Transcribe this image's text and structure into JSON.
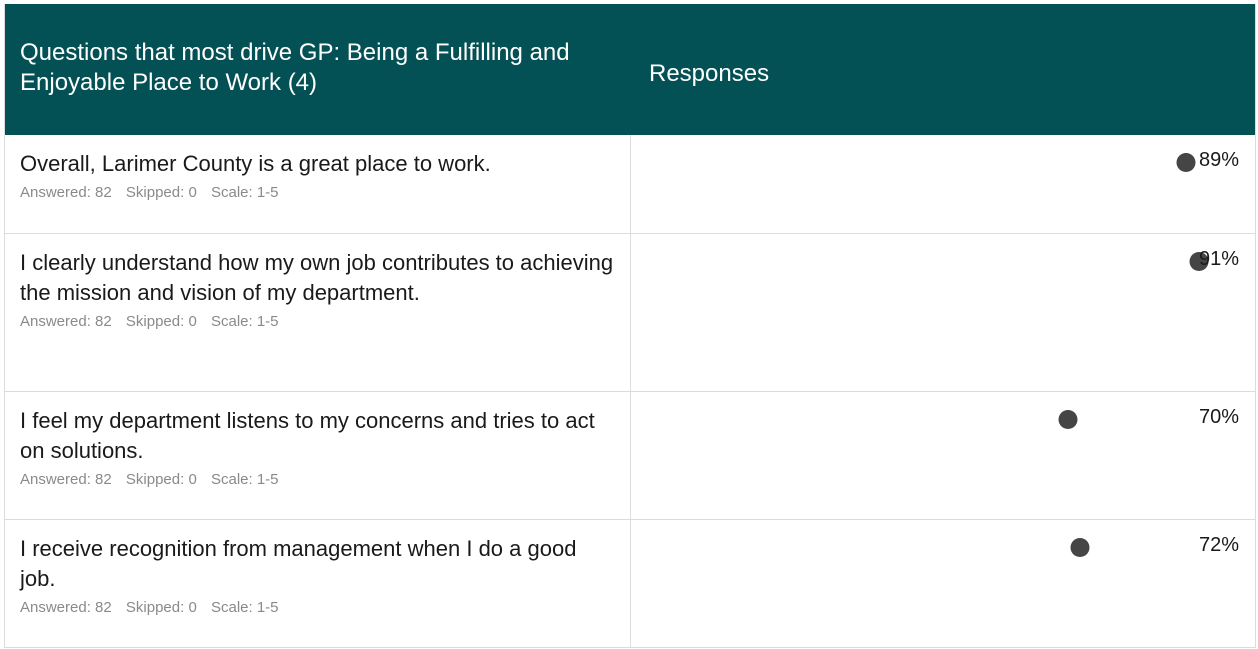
{
  "header": {
    "questions_label": "Questions that most drive GP: Being a Fulfilling and Enjoyable Place to Work (4)",
    "responses_label": "Responses"
  },
  "rows": [
    {
      "question": "Overall, Larimer County is a great place to work.",
      "answered": "Answered: 82",
      "skipped": "Skipped: 0",
      "scale": "Scale: 1-5",
      "percent_label": "89%",
      "percent": 89
    },
    {
      "question": "I clearly understand how my own job contributes to achieving the mission and vision of my department.",
      "answered": "Answered: 82",
      "skipped": "Skipped: 0",
      "scale": "Scale: 1-5",
      "percent_label": "91%",
      "percent": 91
    },
    {
      "question": "I feel my department listens to my concerns and tries to act on solutions.",
      "answered": "Answered: 82",
      "skipped": "Skipped: 0",
      "scale": "Scale: 1-5",
      "percent_label": "70%",
      "percent": 70
    },
    {
      "question": "I receive recognition from management when I do a good job.",
      "answered": "Answered: 82",
      "skipped": "Skipped: 0",
      "scale": "Scale: 1-5",
      "percent_label": "72%",
      "percent": 72
    }
  ],
  "colors": {
    "header_bg": "#045155",
    "dot": "#454545"
  }
}
